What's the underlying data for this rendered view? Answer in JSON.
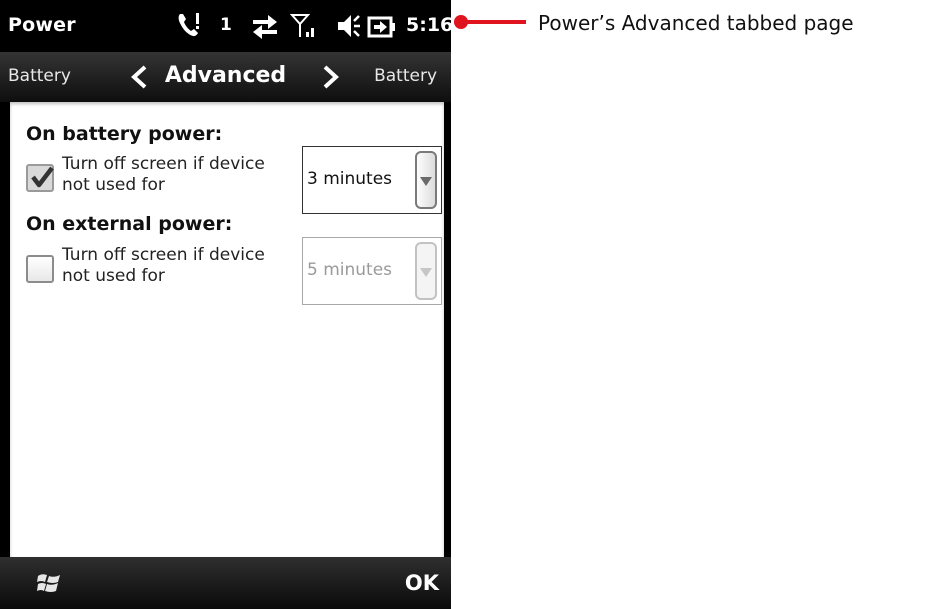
{
  "statusbar": {
    "app_title": "Power",
    "call_badge": "1",
    "time": "5:16"
  },
  "tabs": {
    "previous": "Battery",
    "current": "Advanced",
    "next": "Battery"
  },
  "battery_section": {
    "heading": "On battery power:",
    "checkbox_checked": true,
    "checkbox_label_line1": "Turn off screen if device",
    "checkbox_label_line2": "not used for",
    "dropdown_value": "3 minutes"
  },
  "external_section": {
    "heading": "On external power:",
    "checkbox_checked": false,
    "checkbox_label_line1": "Turn off screen if device",
    "checkbox_label_line2": "not used for",
    "dropdown_value": "5 minutes",
    "dropdown_enabled": false
  },
  "bottombar": {
    "ok_label": "OK"
  },
  "annotation": {
    "text": "Power’s Advanced tabbed page",
    "color": "#e0141e"
  }
}
